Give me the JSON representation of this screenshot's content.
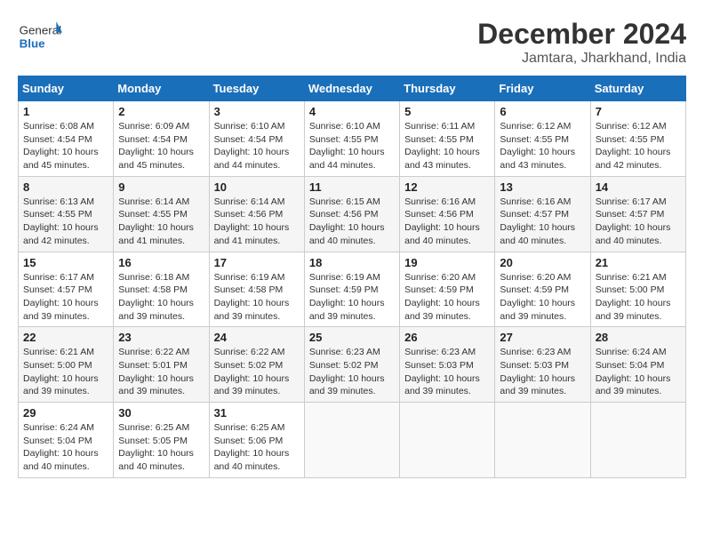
{
  "header": {
    "logo_general": "General",
    "logo_blue": "Blue",
    "month_title": "December 2024",
    "location": "Jamtara, Jharkhand, India"
  },
  "days_of_week": [
    "Sunday",
    "Monday",
    "Tuesday",
    "Wednesday",
    "Thursday",
    "Friday",
    "Saturday"
  ],
  "weeks": [
    [
      {
        "day": "1",
        "lines": [
          "Sunrise: 6:08 AM",
          "Sunset: 4:54 PM",
          "Daylight: 10 hours",
          "and 45 minutes."
        ]
      },
      {
        "day": "2",
        "lines": [
          "Sunrise: 6:09 AM",
          "Sunset: 4:54 PM",
          "Daylight: 10 hours",
          "and 45 minutes."
        ]
      },
      {
        "day": "3",
        "lines": [
          "Sunrise: 6:10 AM",
          "Sunset: 4:54 PM",
          "Daylight: 10 hours",
          "and 44 minutes."
        ]
      },
      {
        "day": "4",
        "lines": [
          "Sunrise: 6:10 AM",
          "Sunset: 4:55 PM",
          "Daylight: 10 hours",
          "and 44 minutes."
        ]
      },
      {
        "day": "5",
        "lines": [
          "Sunrise: 6:11 AM",
          "Sunset: 4:55 PM",
          "Daylight: 10 hours",
          "and 43 minutes."
        ]
      },
      {
        "day": "6",
        "lines": [
          "Sunrise: 6:12 AM",
          "Sunset: 4:55 PM",
          "Daylight: 10 hours",
          "and 43 minutes."
        ]
      },
      {
        "day": "7",
        "lines": [
          "Sunrise: 6:12 AM",
          "Sunset: 4:55 PM",
          "Daylight: 10 hours",
          "and 42 minutes."
        ]
      }
    ],
    [
      {
        "day": "8",
        "lines": [
          "Sunrise: 6:13 AM",
          "Sunset: 4:55 PM",
          "Daylight: 10 hours",
          "and 42 minutes."
        ]
      },
      {
        "day": "9",
        "lines": [
          "Sunrise: 6:14 AM",
          "Sunset: 4:55 PM",
          "Daylight: 10 hours",
          "and 41 minutes."
        ]
      },
      {
        "day": "10",
        "lines": [
          "Sunrise: 6:14 AM",
          "Sunset: 4:56 PM",
          "Daylight: 10 hours",
          "and 41 minutes."
        ]
      },
      {
        "day": "11",
        "lines": [
          "Sunrise: 6:15 AM",
          "Sunset: 4:56 PM",
          "Daylight: 10 hours",
          "and 40 minutes."
        ]
      },
      {
        "day": "12",
        "lines": [
          "Sunrise: 6:16 AM",
          "Sunset: 4:56 PM",
          "Daylight: 10 hours",
          "and 40 minutes."
        ]
      },
      {
        "day": "13",
        "lines": [
          "Sunrise: 6:16 AM",
          "Sunset: 4:57 PM",
          "Daylight: 10 hours",
          "and 40 minutes."
        ]
      },
      {
        "day": "14",
        "lines": [
          "Sunrise: 6:17 AM",
          "Sunset: 4:57 PM",
          "Daylight: 10 hours",
          "and 40 minutes."
        ]
      }
    ],
    [
      {
        "day": "15",
        "lines": [
          "Sunrise: 6:17 AM",
          "Sunset: 4:57 PM",
          "Daylight: 10 hours",
          "and 39 minutes."
        ]
      },
      {
        "day": "16",
        "lines": [
          "Sunrise: 6:18 AM",
          "Sunset: 4:58 PM",
          "Daylight: 10 hours",
          "and 39 minutes."
        ]
      },
      {
        "day": "17",
        "lines": [
          "Sunrise: 6:19 AM",
          "Sunset: 4:58 PM",
          "Daylight: 10 hours",
          "and 39 minutes."
        ]
      },
      {
        "day": "18",
        "lines": [
          "Sunrise: 6:19 AM",
          "Sunset: 4:59 PM",
          "Daylight: 10 hours",
          "and 39 minutes."
        ]
      },
      {
        "day": "19",
        "lines": [
          "Sunrise: 6:20 AM",
          "Sunset: 4:59 PM",
          "Daylight: 10 hours",
          "and 39 minutes."
        ]
      },
      {
        "day": "20",
        "lines": [
          "Sunrise: 6:20 AM",
          "Sunset: 4:59 PM",
          "Daylight: 10 hours",
          "and 39 minutes."
        ]
      },
      {
        "day": "21",
        "lines": [
          "Sunrise: 6:21 AM",
          "Sunset: 5:00 PM",
          "Daylight: 10 hours",
          "and 39 minutes."
        ]
      }
    ],
    [
      {
        "day": "22",
        "lines": [
          "Sunrise: 6:21 AM",
          "Sunset: 5:00 PM",
          "Daylight: 10 hours",
          "and 39 minutes."
        ]
      },
      {
        "day": "23",
        "lines": [
          "Sunrise: 6:22 AM",
          "Sunset: 5:01 PM",
          "Daylight: 10 hours",
          "and 39 minutes."
        ]
      },
      {
        "day": "24",
        "lines": [
          "Sunrise: 6:22 AM",
          "Sunset: 5:02 PM",
          "Daylight: 10 hours",
          "and 39 minutes."
        ]
      },
      {
        "day": "25",
        "lines": [
          "Sunrise: 6:23 AM",
          "Sunset: 5:02 PM",
          "Daylight: 10 hours",
          "and 39 minutes."
        ]
      },
      {
        "day": "26",
        "lines": [
          "Sunrise: 6:23 AM",
          "Sunset: 5:03 PM",
          "Daylight: 10 hours",
          "and 39 minutes."
        ]
      },
      {
        "day": "27",
        "lines": [
          "Sunrise: 6:23 AM",
          "Sunset: 5:03 PM",
          "Daylight: 10 hours",
          "and 39 minutes."
        ]
      },
      {
        "day": "28",
        "lines": [
          "Sunrise: 6:24 AM",
          "Sunset: 5:04 PM",
          "Daylight: 10 hours",
          "and 39 minutes."
        ]
      }
    ],
    [
      {
        "day": "29",
        "lines": [
          "Sunrise: 6:24 AM",
          "Sunset: 5:04 PM",
          "Daylight: 10 hours",
          "and 40 minutes."
        ]
      },
      {
        "day": "30",
        "lines": [
          "Sunrise: 6:25 AM",
          "Sunset: 5:05 PM",
          "Daylight: 10 hours",
          "and 40 minutes."
        ]
      },
      {
        "day": "31",
        "lines": [
          "Sunrise: 6:25 AM",
          "Sunset: 5:06 PM",
          "Daylight: 10 hours",
          "and 40 minutes."
        ]
      },
      null,
      null,
      null,
      null
    ]
  ]
}
